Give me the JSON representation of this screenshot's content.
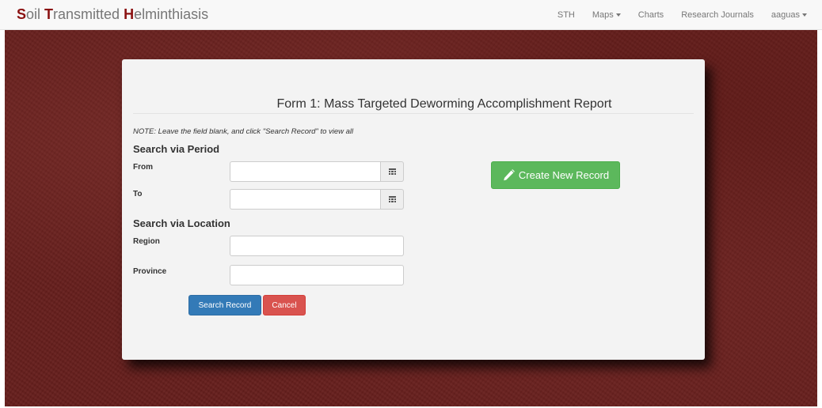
{
  "navbar": {
    "brand": [
      {
        "cap": "S",
        "rest": "oil "
      },
      {
        "cap": "T",
        "rest": "ransmitted "
      },
      {
        "cap": "H",
        "rest": "elminthiasis"
      }
    ],
    "links": {
      "sth": "STH",
      "maps": "Maps",
      "charts": "Charts",
      "journals": "Research Journals",
      "user": "aaguas"
    }
  },
  "form": {
    "title": "Form 1: Mass Targeted Deworming Accomplishment Report",
    "note": "NOTE: Leave the field blank, and click \"Search Record\" to view all",
    "period": {
      "heading": "Search via Period",
      "from_label": "From",
      "from_value": "",
      "to_label": "To",
      "to_value": ""
    },
    "location": {
      "heading": "Search via Location",
      "region_label": "Region",
      "region_value": "",
      "province_label": "Province",
      "province_value": ""
    },
    "buttons": {
      "search": "Search Record",
      "cancel": "Cancel",
      "create": "Create New Record"
    }
  },
  "icons": {
    "calendar": "calendar-icon",
    "pencil": "pencil-icon",
    "caret": "caret-down-icon"
  },
  "colors": {
    "brand_accent": "#8a1010",
    "background": "#651e1c",
    "primary": "#337ab7",
    "danger": "#d9534f",
    "success": "#5cb85c"
  }
}
